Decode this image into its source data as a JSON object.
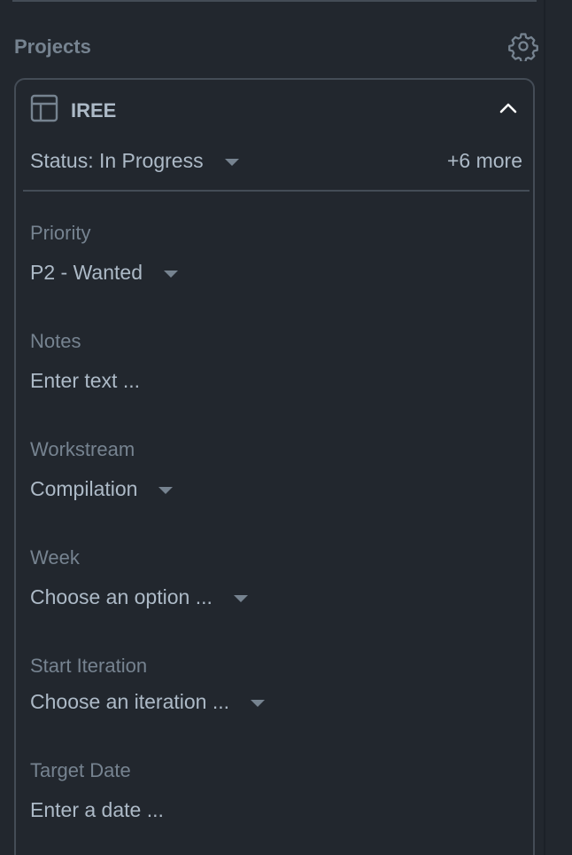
{
  "section": {
    "title": "Projects",
    "settings_icon": "gear-icon"
  },
  "project": {
    "icon": "table-icon",
    "name": "IREE",
    "collapse_icon": "chevron-up-icon",
    "status": "Status: In Progress",
    "more": "+6 more"
  },
  "fields": {
    "priority": {
      "label": "Priority",
      "value": "P2 - Wanted"
    },
    "notes": {
      "label": "Notes",
      "placeholder": "Enter text ..."
    },
    "workstream": {
      "label": "Workstream",
      "value": "Compilation"
    },
    "week": {
      "label": "Week",
      "placeholder": "Choose an option ..."
    },
    "start_iteration": {
      "label": "Start Iteration",
      "placeholder": "Choose an iteration ..."
    },
    "target_date": {
      "label": "Target Date",
      "placeholder": "Enter a date ..."
    }
  },
  "colors": {
    "background": "#22272e",
    "border": "#444c56",
    "text": "#adbac7",
    "muted": "#768390"
  }
}
